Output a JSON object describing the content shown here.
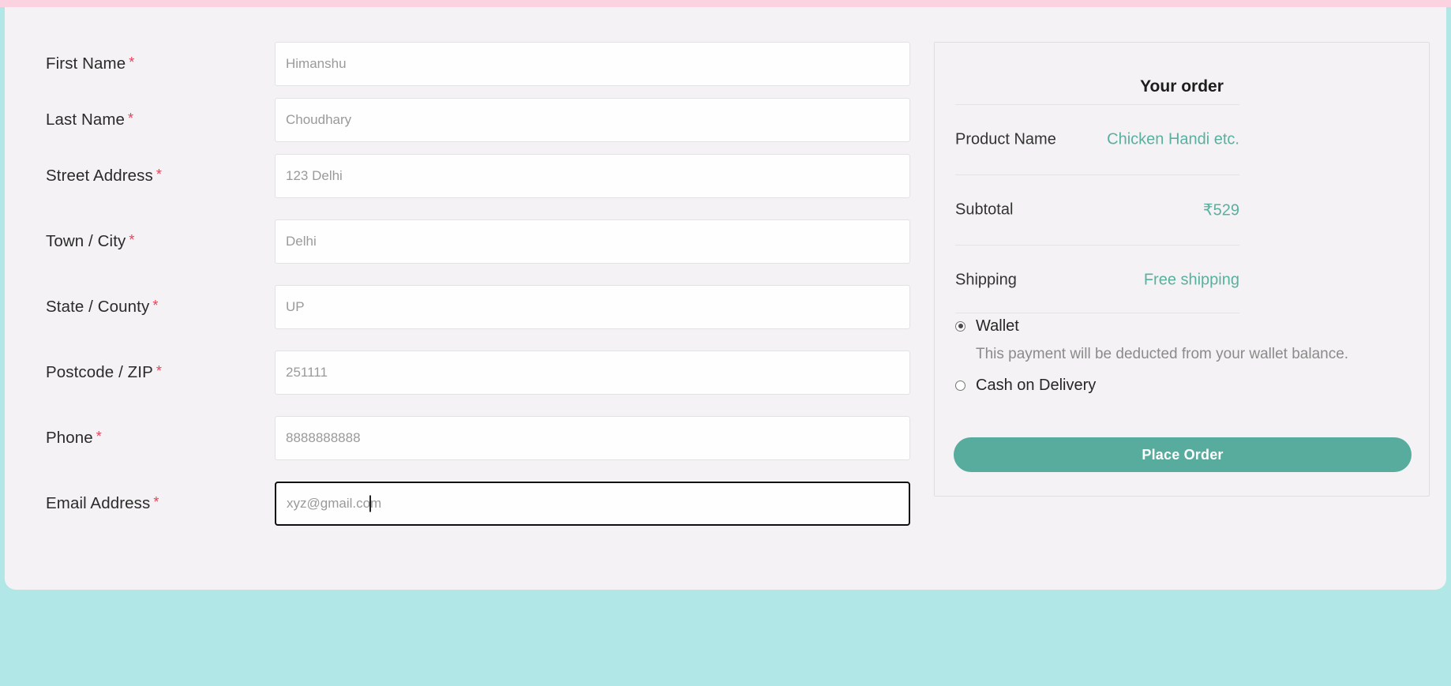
{
  "theme": {
    "top_strip_color": "#fbd3e0",
    "page_bg_color": "#f4f2f4",
    "bottom_band_color": "#b2e7e8",
    "accent_teal": "#58b09f",
    "button_teal": "#57ac9e",
    "required_star_color": "#e8415a"
  },
  "billing_form": {
    "required_marker": "*",
    "fields": [
      {
        "label": "First Name",
        "placeholder": "Himanshu",
        "value": "",
        "name": "first-name",
        "focused": false
      },
      {
        "label": "Last Name",
        "placeholder": "Choudhary",
        "value": "",
        "name": "last-name",
        "focused": false
      },
      {
        "label": "Street Address",
        "placeholder": "123 Delhi",
        "value": "",
        "name": "street-address",
        "focused": false
      },
      {
        "label": "Town / City",
        "placeholder": "Delhi",
        "value": "",
        "name": "town-city",
        "focused": false
      },
      {
        "label": "State / County",
        "placeholder": "UP",
        "value": "",
        "name": "state-county",
        "focused": false
      },
      {
        "label": "Postcode / ZIP",
        "placeholder": "251111",
        "value": "",
        "name": "postcode-zip",
        "focused": false
      },
      {
        "label": "Phone",
        "placeholder": "8888888888",
        "value": "",
        "name": "phone",
        "focused": false
      },
      {
        "label": "Email Address",
        "placeholder": "xyz@gmail.com",
        "value": "",
        "name": "email-address",
        "focused": true
      }
    ]
  },
  "order_summary": {
    "title": "Your order",
    "rows": [
      {
        "label": "Product Name",
        "value": "Chicken Handi etc."
      },
      {
        "label": "Subtotal",
        "value": "₹529"
      },
      {
        "label": "Shipping",
        "value": "Free shipping"
      }
    ],
    "payment_methods": [
      {
        "label": "Wallet",
        "selected": true,
        "description": "This payment will be deducted from your wallet balance."
      },
      {
        "label": "Cash on Delivery",
        "selected": false,
        "description": ""
      }
    ],
    "place_order_label": "Place Order"
  }
}
